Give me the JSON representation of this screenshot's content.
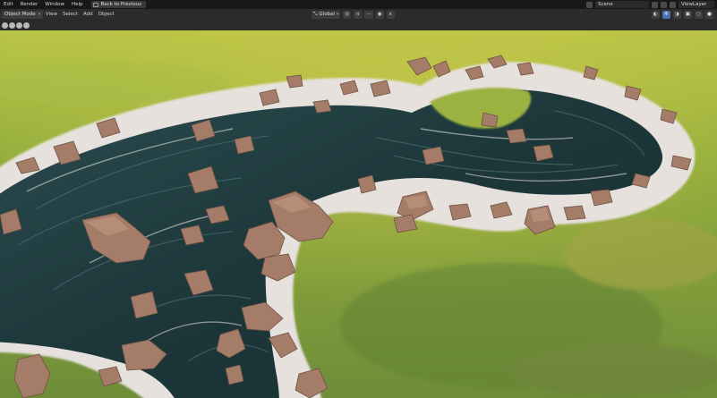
{
  "topbar": {
    "menus": [
      "Edit",
      "Render",
      "Window",
      "Help"
    ],
    "back_button": "Back to Previous",
    "scene": "Scene",
    "view_layer": "ViewLayer"
  },
  "header": {
    "mode": "Object Mode",
    "menus": [
      "View",
      "Select",
      "Add",
      "Object"
    ],
    "transform_orientation": "Global"
  },
  "viewport": {
    "colors": {
      "grass": "#8ea83f",
      "water": "#1f3a3e",
      "foam": "#e9e4df",
      "rock": "#a57c68"
    }
  }
}
